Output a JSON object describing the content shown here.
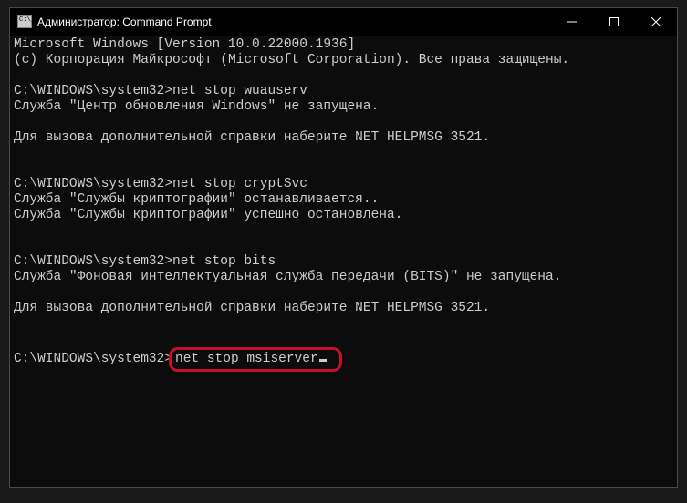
{
  "titlebar": {
    "title": "Администратор: Command Prompt"
  },
  "terminal": {
    "line1": "Microsoft Windows [Version 10.0.22000.1936]",
    "line2": "(c) Корпорация Майкрософт (Microsoft Corporation). Все права защищены.",
    "prompt1": "C:\\WINDOWS\\system32>",
    "cmd1": "net stop wuauserv",
    "resp1": "Служба \"Центр обновления Windows\" не запущена.",
    "help1": "Для вызова дополнительной справки наберите NET HELPMSG 3521.",
    "prompt2": "C:\\WINDOWS\\system32>",
    "cmd2": "net stop cryptSvc",
    "resp2a": "Служба \"Службы криптографии\" останавливается..",
    "resp2b": "Служба \"Службы криптографии\" успешно остановлена.",
    "prompt3": "C:\\WINDOWS\\system32>",
    "cmd3": "net stop bits",
    "resp3": "Служба \"Фоновая интеллектуальная служба передачи (BITS)\" не запущена.",
    "help3": "Для вызова дополнительной справки наберите NET HELPMSG 3521.",
    "prompt4": "C:\\WINDOWS\\system32>",
    "cmd4": "net stop msiserver"
  }
}
